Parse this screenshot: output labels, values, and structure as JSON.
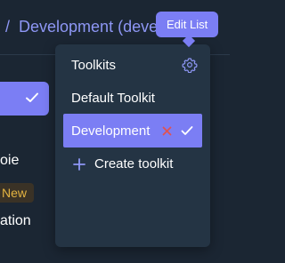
{
  "header": {
    "separator": "/",
    "breadcrumb_current": "Development (deve"
  },
  "left_panel": {
    "partial_label_1": "oie",
    "badge_new": "New",
    "partial_label_2": "ation"
  },
  "dropdown": {
    "title": "Toolkits",
    "items": [
      {
        "label": "Default Toolkit",
        "selected": false
      },
      {
        "label": "Development",
        "selected": true
      }
    ],
    "create_label": "Create toolkit"
  },
  "tooltip": {
    "text": "Edit List"
  },
  "colors": {
    "background": "#1b2633",
    "dropdown": "#243444",
    "accent": "#7b7ef4",
    "breadcrumb": "#8e97f5",
    "delete": "#e05252",
    "badge_text": "#e3b341"
  },
  "icons": {
    "settings": "gear-icon",
    "remove": "close-icon",
    "selected": "check-icon",
    "create": "plus-icon"
  }
}
